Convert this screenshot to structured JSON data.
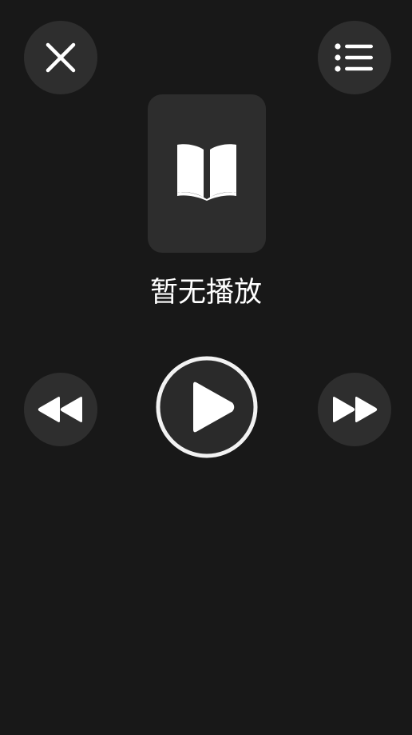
{
  "player": {
    "status_text": "暂无播放"
  },
  "icons": {
    "close": "close-icon",
    "playlist": "list-icon",
    "cover": "book-icon",
    "rewind": "rewind-icon",
    "play": "play-icon",
    "forward": "fast-forward-icon"
  },
  "colors": {
    "background": "#181818",
    "button_bg": "#2e2e2e",
    "cover_bg": "#2d2d2d",
    "icon": "#ffffff",
    "play_ring": "#f2f2f2"
  }
}
